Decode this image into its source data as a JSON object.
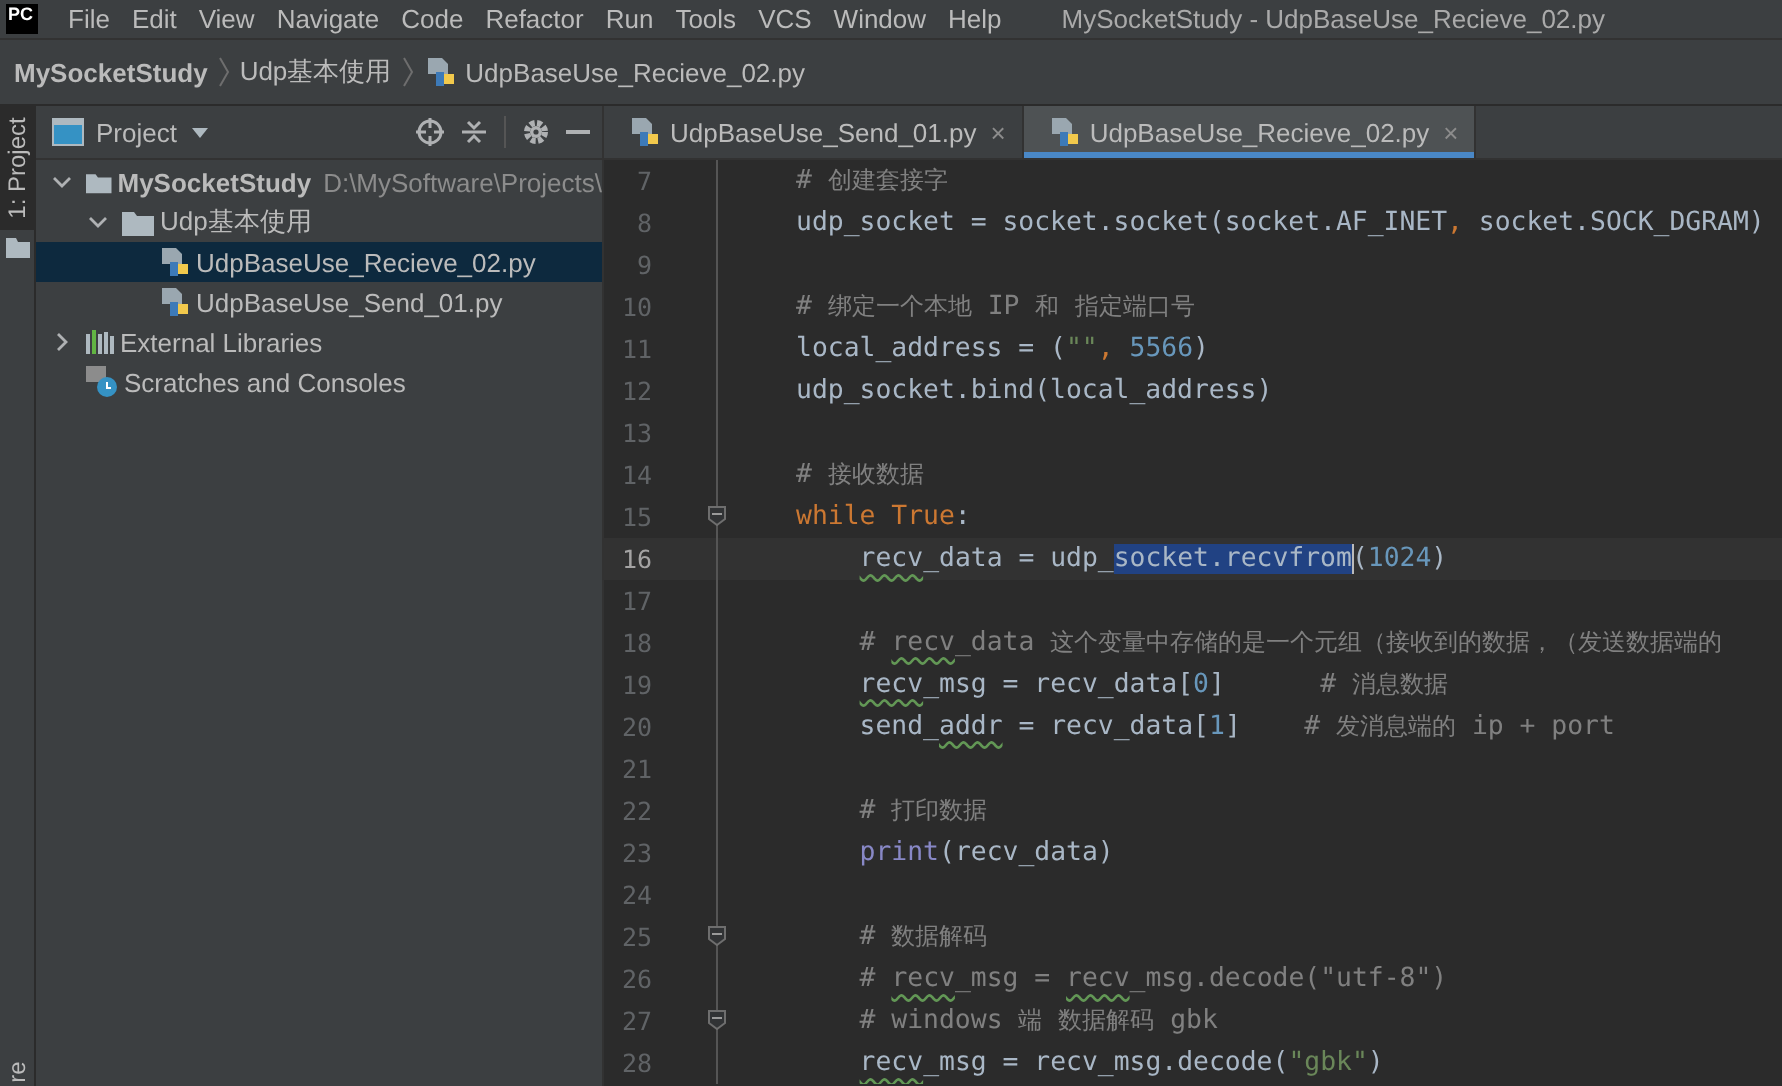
{
  "app_logo": "PC",
  "menu": [
    "File",
    "Edit",
    "View",
    "Navigate",
    "Code",
    "Refactor",
    "Run",
    "Tools",
    "VCS",
    "Window",
    "Help"
  ],
  "window": {
    "title": "MySocketStudy - UdpBaseUse_Recieve_02.py"
  },
  "breadcrumbs": [
    {
      "label": "MySocketStudy",
      "kind": "project"
    },
    {
      "label": "Udp基本使用",
      "kind": "folder"
    },
    {
      "label": "UdpBaseUse_Recieve_02.py",
      "kind": "file"
    }
  ],
  "side_stripe": [
    {
      "label": "1: Project",
      "selected": true
    },
    {
      "label": "re",
      "selected": false
    }
  ],
  "project_panel": {
    "title": "Project",
    "tree": [
      {
        "label": "MySocketStudy",
        "path": "D:\\MySoftware\\Projects\\",
        "kind": "root",
        "expanded": true,
        "selected": false,
        "children": [
          {
            "label": "Udp基本使用",
            "kind": "folder",
            "expanded": true,
            "selected": false,
            "children": [
              {
                "label": "UdpBaseUse_Recieve_02.py",
                "kind": "python",
                "selected": true
              },
              {
                "label": "UdpBaseUse_Send_01.py",
                "kind": "python",
                "selected": false
              }
            ]
          }
        ]
      },
      {
        "label": "External Libraries",
        "kind": "libraries",
        "expanded": false,
        "selected": false
      },
      {
        "label": "Scratches and Consoles",
        "kind": "scratches",
        "selected": false
      }
    ]
  },
  "editor_tabs": [
    {
      "label": "UdpBaseUse_Send_01.py",
      "close": "×",
      "selected": false
    },
    {
      "label": "UdpBaseUse_Recieve_02.py",
      "close": "×",
      "selected": true
    }
  ],
  "code_lines": [
    {
      "number": "7",
      "current": false,
      "fold": false,
      "segments": [
        {
          "text": "# 创建套接字",
          "kind": "comment"
        }
      ]
    },
    {
      "number": "8",
      "current": false,
      "fold": false,
      "segments": [
        {
          "text": "udp_socket = socket.socket(socket.AF_INET",
          "kind": "plain"
        },
        {
          "text": ",",
          "kind": "keyword"
        },
        {
          "text": " socket.SOCK_DGRAM)",
          "kind": "plain"
        }
      ]
    },
    {
      "number": "9",
      "current": false,
      "fold": false
    },
    {
      "number": "10",
      "current": false,
      "fold": false,
      "segments": [
        {
          "text": "# 绑定一个本地 IP 和 指定端口号",
          "kind": "comment"
        }
      ]
    },
    {
      "number": "11",
      "current": false,
      "fold": false,
      "segments": [
        {
          "text": "local_address = (",
          "kind": "plain"
        },
        {
          "text": "\"\"",
          "kind": "string"
        },
        {
          "text": ", ",
          "kind": "keyword"
        },
        {
          "text": "5566",
          "kind": "number"
        },
        {
          "text": ")",
          "kind": "plain"
        }
      ]
    },
    {
      "number": "12",
      "current": false,
      "fold": false,
      "segments": [
        {
          "text": "udp_socket.bind(local_address)",
          "kind": "plain"
        }
      ]
    },
    {
      "number": "13",
      "current": false,
      "fold": false
    },
    {
      "number": "14",
      "current": false,
      "fold": false,
      "segments": [
        {
          "text": "# 接收数据",
          "kind": "comment"
        }
      ]
    },
    {
      "number": "15",
      "current": false,
      "fold": true,
      "segments": [
        {
          "text": "while True",
          "kind": "keyword"
        },
        {
          "text": ":",
          "kind": "plain"
        }
      ],
      "children": [
        {
          "number": "16",
          "current": true,
          "fold": false,
          "segments": [
            {
              "text": "recv",
              "kind": "typo"
            },
            {
              "text": "_data = udp_",
              "kind": "plain"
            },
            {
              "text": "socket.recvfrom",
              "kind": "selected"
            },
            {
              "text": "(",
              "kind": "plain"
            },
            {
              "text": "1024",
              "kind": "number"
            },
            {
              "text": ")",
              "kind": "plain"
            }
          ]
        },
        {
          "number": "17",
          "current": false,
          "fold": false
        },
        {
          "number": "18",
          "current": false,
          "fold": false,
          "segments": [
            {
              "text": "# ",
              "kind": "comment"
            },
            {
              "text": "recv",
              "kind": "comment-typo"
            },
            {
              "text": "_data 这个变量中存储的是一个元组（接收到的数据，（发送数据端的",
              "kind": "comment"
            }
          ]
        },
        {
          "number": "19",
          "current": false,
          "fold": false,
          "segments": [
            {
              "text": "recv",
              "kind": "typo"
            },
            {
              "text": "_msg = recv_data[",
              "kind": "plain"
            },
            {
              "text": "0",
              "kind": "number"
            },
            {
              "text": "]      ",
              "kind": "plain"
            },
            {
              "text": "# 消息数据",
              "kind": "comment"
            }
          ]
        },
        {
          "number": "20",
          "current": false,
          "fold": false,
          "segments": [
            {
              "text": "send_",
              "kind": "plain"
            },
            {
              "text": "addr",
              "kind": "typo"
            },
            {
              "text": " = recv_data[",
              "kind": "plain"
            },
            {
              "text": "1",
              "kind": "number"
            },
            {
              "text": "]    ",
              "kind": "plain"
            },
            {
              "text": "# 发消息端的 ip + port",
              "kind": "comment"
            }
          ]
        },
        {
          "number": "21",
          "current": false,
          "fold": false
        },
        {
          "number": "22",
          "current": false,
          "fold": false,
          "segments": [
            {
              "text": "# 打印数据",
              "kind": "comment"
            }
          ]
        },
        {
          "number": "23",
          "current": false,
          "fold": false,
          "segments": [
            {
              "text": "print",
              "kind": "builtin"
            },
            {
              "text": "(recv_data)",
              "kind": "plain"
            }
          ]
        },
        {
          "number": "24",
          "current": false,
          "fold": false
        },
        {
          "number": "25",
          "current": false,
          "fold": true,
          "segments": [
            {
              "text": "# 数据解码",
              "kind": "comment"
            }
          ]
        },
        {
          "number": "26",
          "current": false,
          "fold": false,
          "segments": [
            {
              "text": "# ",
              "kind": "comment"
            },
            {
              "text": "recv",
              "kind": "comment-typo"
            },
            {
              "text": "_msg = ",
              "kind": "comment"
            },
            {
              "text": "recv",
              "kind": "comment-typo"
            },
            {
              "text": "_msg.decode(\"utf-8\")",
              "kind": "comment"
            }
          ]
        },
        {
          "number": "27",
          "current": false,
          "fold": true,
          "segments": [
            {
              "text": "# windows 端 数据解码 gbk",
              "kind": "comment"
            }
          ]
        },
        {
          "number": "28",
          "current": false,
          "fold": false,
          "segments": [
            {
              "text": "recv",
              "kind": "typo"
            },
            {
              "text": "_msg = recv_msg.decode(",
              "kind": "plain"
            },
            {
              "text": "\"gbk\"",
              "kind": "string"
            },
            {
              "text": ")",
              "kind": "plain"
            }
          ]
        }
      ]
    }
  ]
}
